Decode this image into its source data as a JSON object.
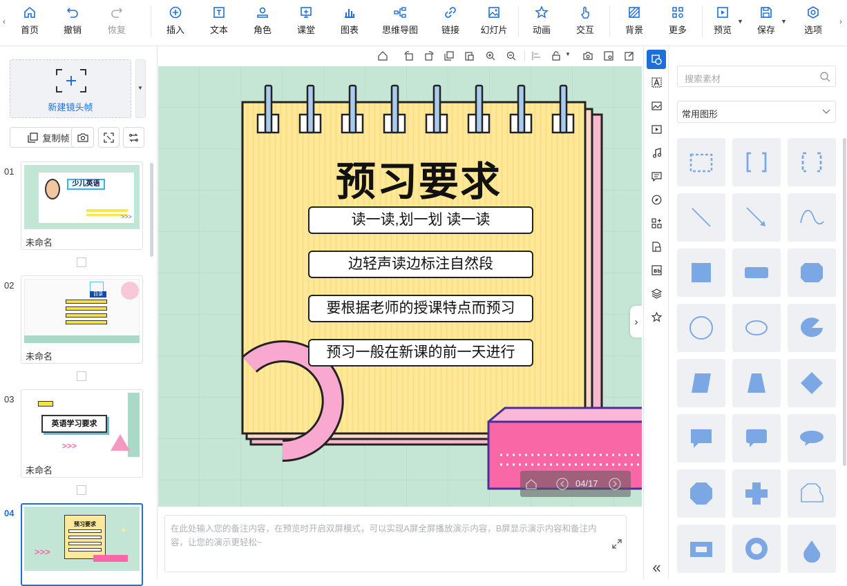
{
  "toolbar": {
    "items": [
      {
        "label": "首页",
        "icon": "home-icon"
      },
      {
        "label": "撤销",
        "icon": "undo-icon"
      },
      {
        "label": "恢复",
        "icon": "redo-icon"
      },
      {
        "label": "插入",
        "icon": "plus-circle-icon"
      },
      {
        "label": "文本",
        "icon": "text-icon"
      },
      {
        "label": "角色",
        "icon": "person-icon"
      },
      {
        "label": "课堂",
        "icon": "classroom-icon"
      },
      {
        "label": "图表",
        "icon": "chart-icon"
      },
      {
        "label": "思维导图",
        "icon": "mindmap-icon"
      },
      {
        "label": "链接",
        "icon": "link-icon"
      },
      {
        "label": "幻灯片",
        "icon": "image-icon"
      },
      {
        "label": "动画",
        "icon": "star-icon"
      },
      {
        "label": "交互",
        "icon": "hand-icon"
      },
      {
        "label": "背景",
        "icon": "background-icon"
      },
      {
        "label": "更多",
        "icon": "grid-icon"
      },
      {
        "label": "预览",
        "icon": "play-icon"
      },
      {
        "label": "保存",
        "icon": "save-icon"
      },
      {
        "label": "选项",
        "icon": "settings-icon"
      }
    ]
  },
  "left": {
    "new_frame_label": "新建镜头帧",
    "copy_frame_label": "复制帧",
    "slides": [
      {
        "num": "01",
        "name": "未命名",
        "thumb_title": "少儿英语"
      },
      {
        "num": "02",
        "name": "未命名",
        "thumb_title": "目录"
      },
      {
        "num": "03",
        "name": "未命名",
        "thumb_title": "英语学习要求"
      },
      {
        "num": "04",
        "name": "",
        "thumb_title": "预习要求"
      }
    ]
  },
  "canvas": {
    "title": "预习要求",
    "items": [
      "读一读,划一划 读一读",
      "边轻声读边标注自然段",
      "要根据老师的授课特点而预习",
      "预习一般在新课的前一天进行"
    ],
    "page_indicator": "04/17"
  },
  "notes": {
    "placeholder": "在此处输入您的备注内容，在预览时开启双屏模式，可以实现A屏全屏播放演示内容，B屏显示演示内容和备注内容，让您的演示更轻松~"
  },
  "panel": {
    "search_placeholder": "搜索素材",
    "category": "常用图形"
  },
  "colors": {
    "accent": "#1e6fd9",
    "canvas_bg": "#c5e5d5",
    "note_yellow": "#fee89a",
    "pink": "#f967a6",
    "shape_blue": "#7ba8e4"
  }
}
